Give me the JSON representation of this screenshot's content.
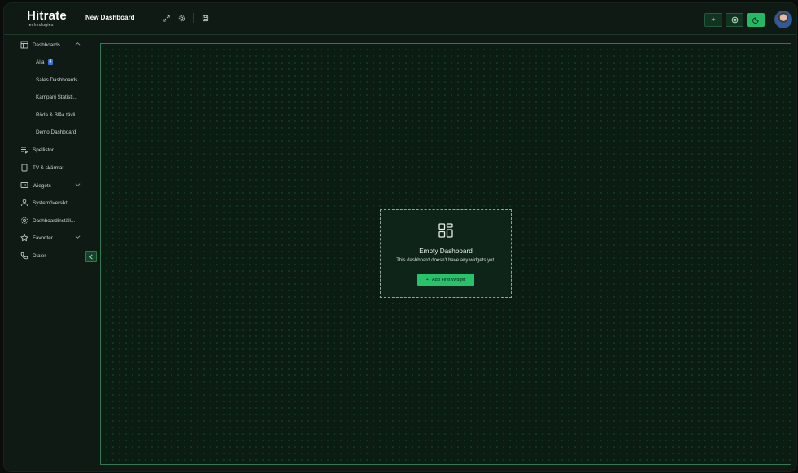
{
  "brand": {
    "name": "Hitrate",
    "sub": "technologies"
  },
  "header": {
    "title": "New Dashboard",
    "icons": [
      "expand-icon",
      "settings-icon",
      "save-icon"
    ],
    "right_buttons": [
      "plus-icon",
      "smiley-icon",
      "moon-icon"
    ],
    "add_symbol": "+"
  },
  "sidebar": {
    "dashboards_label": "Dashboards",
    "sub_items": [
      {
        "label": "Alla",
        "badge": "4"
      },
      {
        "label": "Sales Dashboards"
      },
      {
        "label": "Kampanj Statisti..."
      },
      {
        "label": "Röda & Blåa tävli..."
      },
      {
        "label": "Demo Dashboard"
      }
    ],
    "items": [
      {
        "label": "Spellistor",
        "icon": "playlist-icon"
      },
      {
        "label": "TV & skärmar",
        "icon": "tablet-icon"
      },
      {
        "label": "Widgets",
        "icon": "widgets-icon"
      },
      {
        "label": "Systemöversikt",
        "icon": "users-icon"
      },
      {
        "label": "Dashboardinställ...",
        "icon": "gear-icon"
      },
      {
        "label": "Favoriter",
        "icon": "star-icon"
      },
      {
        "label": "Dialer",
        "icon": "phone-icon"
      }
    ]
  },
  "empty_state": {
    "title": "Empty Dashboard",
    "description": "This dashboard doesn't have any widgets yet.",
    "button_label": "Add First Widget",
    "button_symbol": "+"
  },
  "colors": {
    "accent": "#29c26b",
    "background": "#0f1a14",
    "canvas": "#0b1d13",
    "badge": "#3c72d6"
  }
}
